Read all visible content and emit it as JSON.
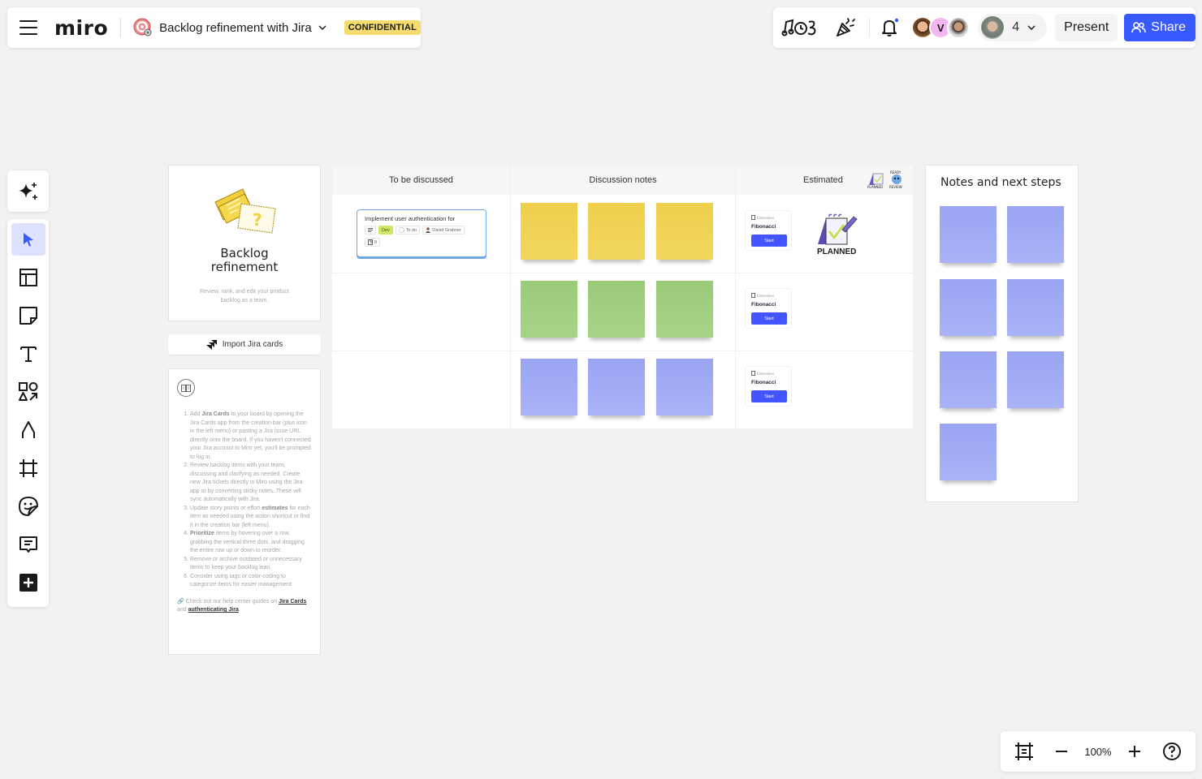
{
  "topbar": {
    "logo": "miro",
    "board_title": "Backlog refinement with Jira",
    "badge": "CONFIDENTIAL",
    "collaborator_count": "4",
    "avatar_initial": "V",
    "present_label": "Present",
    "share_label": "Share",
    "icons": [
      "menu-icon",
      "board-target-icon",
      "chevron-down-icon",
      "music-timer-icon",
      "celebrate-icon",
      "bell-icon",
      "share-people-icon"
    ]
  },
  "toolbar": {
    "tools": [
      {
        "name": "select",
        "icon": "cursor-icon",
        "active": true
      },
      {
        "name": "templates",
        "icon": "template-icon"
      },
      {
        "name": "sticky-note",
        "icon": "sticky-note-icon"
      },
      {
        "name": "text",
        "icon": "text-icon"
      },
      {
        "name": "shapes",
        "icon": "shapes-icon"
      },
      {
        "name": "pen",
        "icon": "pen-icon"
      },
      {
        "name": "frame",
        "icon": "frame-icon"
      },
      {
        "name": "stickers",
        "icon": "sticker-icon"
      },
      {
        "name": "comment",
        "icon": "comment-icon"
      },
      {
        "name": "more-apps",
        "icon": "plus-icon"
      }
    ]
  },
  "zoombar": {
    "zoom_level": "100%"
  },
  "board": {
    "intro": {
      "title_line1": "Backlog",
      "title_line2": "refinement",
      "subtitle": "Review, rank, and edit your product backlog as a team."
    },
    "import_button": "Import Jira cards",
    "instructions": {
      "items": [
        {
          "pre": "Add ",
          "bold": "Jira Cards",
          "post": " to your board by opening the Jira Cards app from the creation bar (plus icon in the left menu) or pasting a Jira issue URL directly onto the board. If you haven't connected your Jira account to Miro yet, you'll be prompted to log in."
        },
        {
          "pre": "Review backlog items with your team, discussing and clarifying as needed. Create new Jira tickets directly in Miro using the Jira app or by converting sticky notes. These will sync automatically with Jira.",
          "bold": "",
          "post": ""
        },
        {
          "pre": "Update story points or effort ",
          "bold": "estimates",
          "post": " for each item as needed using the action shortcut or find it in the creation bar (left menu)."
        },
        {
          "pre": "",
          "bold": "Prioritize",
          "post": " items by hovering over a row, grabbing the vertical three dots, and dragging the entire row up or down to reorder."
        },
        {
          "pre": "Remove or archive outdated or unnecessary items to keep your backlog lean.",
          "bold": "",
          "post": ""
        },
        {
          "pre": "Consider using tags or color-coding to categorize items for easier management.",
          "bold": "",
          "post": ""
        }
      ],
      "footer_pre": "Check out our help center guides on ",
      "footer_link1": "Jira Cards",
      "footer_mid": " and ",
      "footer_link2": "authenticating Jira",
      "footer_post": "."
    },
    "table": {
      "columns": [
        "To be discussed",
        "Discussion notes",
        "Estimated"
      ],
      "header_stickers": [
        "PLANNED",
        "REVIEW"
      ],
      "rows": [
        {
          "jira_card": {
            "title": "Implement user authentication for",
            "tag": "Dev",
            "status": "To do",
            "assignee": "David Grabner",
            "story_points": "8"
          },
          "sticky_color": "yellow",
          "sticky_count": 3,
          "estimation": {
            "label": "Estimation",
            "scale": "Fibonacci",
            "button": "Start"
          },
          "sticker": "PLANNED"
        },
        {
          "sticky_color": "green",
          "sticky_count": 3,
          "estimation": {
            "label": "Estimation",
            "scale": "Fibonacci",
            "button": "Start"
          }
        },
        {
          "sticky_color": "violet",
          "sticky_count": 3,
          "estimation": {
            "label": "Estimation",
            "scale": "Fibonacci",
            "button": "Start"
          }
        }
      ]
    },
    "notes": {
      "title": "Notes and next steps",
      "sticky_color": "violet",
      "sticky_count": 7
    }
  },
  "colors": {
    "accent": "#3859ff",
    "badge": "#f5dc6e",
    "sticky_yellow": "#f0d250",
    "sticky_green": "#9fcf7f",
    "sticky_violet": "#a2abf5",
    "jira_border": "#6ea7e6",
    "dev_tag": "#cde866"
  }
}
